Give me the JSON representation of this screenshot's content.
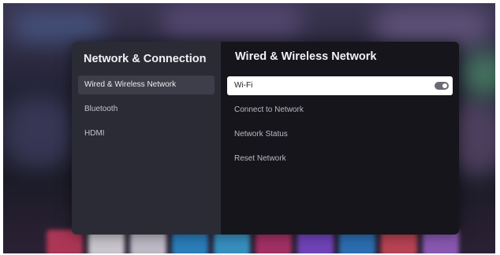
{
  "left_panel": {
    "title": "Network & Connection",
    "items": [
      {
        "label": "Wired & Wireless Network"
      },
      {
        "label": "Bluetooth"
      },
      {
        "label": "HDMI"
      }
    ]
  },
  "right_panel": {
    "title": "Wired & Wireless Network",
    "options": [
      {
        "label": "Wi-Fi",
        "toggle_on": false
      },
      {
        "label": "Connect to Network"
      },
      {
        "label": "Network Status"
      },
      {
        "label": "Reset Network"
      }
    ]
  },
  "colors": {
    "selected_bg": "#ffffff",
    "left_panel_bg": "#2b2b36",
    "right_panel_bg": "#15151b"
  }
}
